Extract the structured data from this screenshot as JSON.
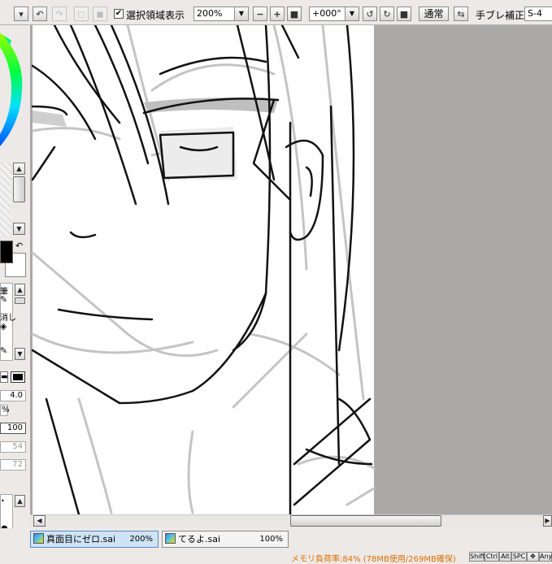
{
  "toolbar": {
    "selection_checkbox_checked": true,
    "selection_label": "選択領域表示",
    "zoom_value": "200%",
    "zoom_minus": "−",
    "zoom_plus": "+",
    "rotation_value": "+000°",
    "blend_mode": "通常",
    "stabilizer_label": "手ブレ補正",
    "stabilizer_value": "S-4"
  },
  "left_panel": {
    "brush_size": "4.0",
    "density": "100",
    "value_54": "54",
    "value_72": "72",
    "label_partial_1": "筆",
    "label_partial_2": "消し",
    "percent_partial": "%"
  },
  "tabs": [
    {
      "name": "真面目にゼロ.sai",
      "zoom": "200%",
      "active": true
    },
    {
      "name": "てるよ.sai",
      "zoom": "100%",
      "active": false
    }
  ],
  "status": {
    "memory_text": "メモリ負荷率:84% (78MB使用/269MB確保)",
    "keys": [
      "Shift",
      "Ctrl",
      "Alt",
      "SPC",
      "Any"
    ],
    "memory_color": "#e07000"
  },
  "colors": {
    "foreground": "#000000",
    "background": "#ffffff",
    "canvas_bg": "#aba8a8"
  }
}
